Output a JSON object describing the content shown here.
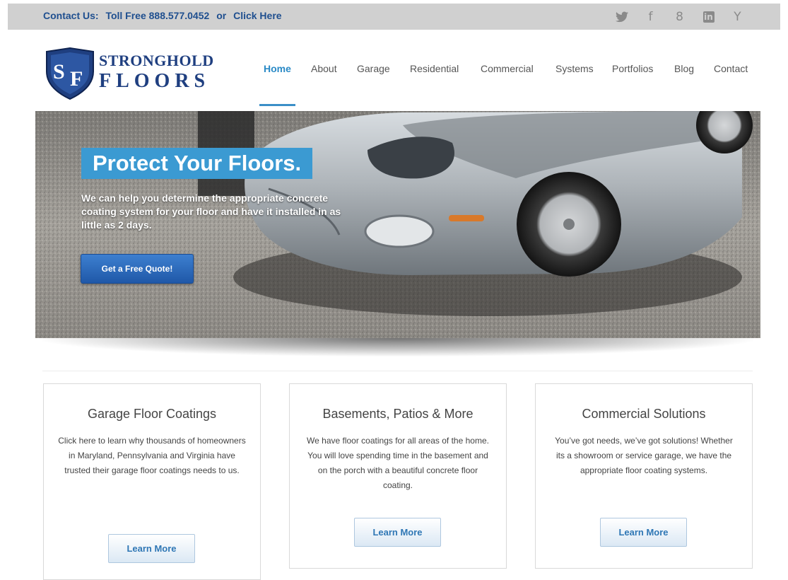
{
  "topbar": {
    "contact": {
      "label": "Contact Us:",
      "phone": "Toll Free 888.577.0452",
      "or": "or",
      "link": "Click Here"
    },
    "social": [
      {
        "icon": "twitter-icon",
        "glyph": "🐦"
      },
      {
        "icon": "facebook-icon",
        "glyph": "f"
      },
      {
        "icon": "google-plus-icon",
        "glyph": "8"
      },
      {
        "icon": "linkedin-icon",
        "glyph": "in"
      },
      {
        "icon": "yelp-icon",
        "glyph": "Y"
      }
    ]
  },
  "logo": {
    "monogram": "SF",
    "line1": "STRONGHOLD",
    "line2": "FLOORS"
  },
  "nav": {
    "items": [
      "Home",
      "About",
      "Garage",
      "Residential",
      "Commercial",
      "Systems",
      "Portfolios",
      "Blog",
      "Contact"
    ],
    "active": "Home"
  },
  "hero": {
    "headline": "Protect Your Floors.",
    "subtext": "We can help you determine the appropriate concrete coating system for your floor and have it installed in as little as 2 days.",
    "cta": "Get a Free Quote!"
  },
  "features": [
    {
      "title": "Garage Floor Coatings",
      "body": "Click here to learn why thousands of homeowners in Maryland, Pennsylvania and Virginia have trusted their garage floor coatings needs to us.",
      "button": "Learn More"
    },
    {
      "title": "Basements, Patios & More",
      "body": "We have floor coatings for all areas of the home. You will love spending time in the basement and on the porch with a beautiful concrete floor coating.",
      "button": "Learn More"
    },
    {
      "title": "Commercial Solutions",
      "body": "You’ve got needs, we’ve got solutions! Whether its a showroom or service garage, we have the appropriate floor coating systems.",
      "button": "Learn More"
    }
  ],
  "colors": {
    "topbar_bg": "#d0d0d0",
    "brand_navy": "#1f3f80",
    "accent_blue": "#3b9ad2",
    "nav_active": "#2a8ac6"
  }
}
